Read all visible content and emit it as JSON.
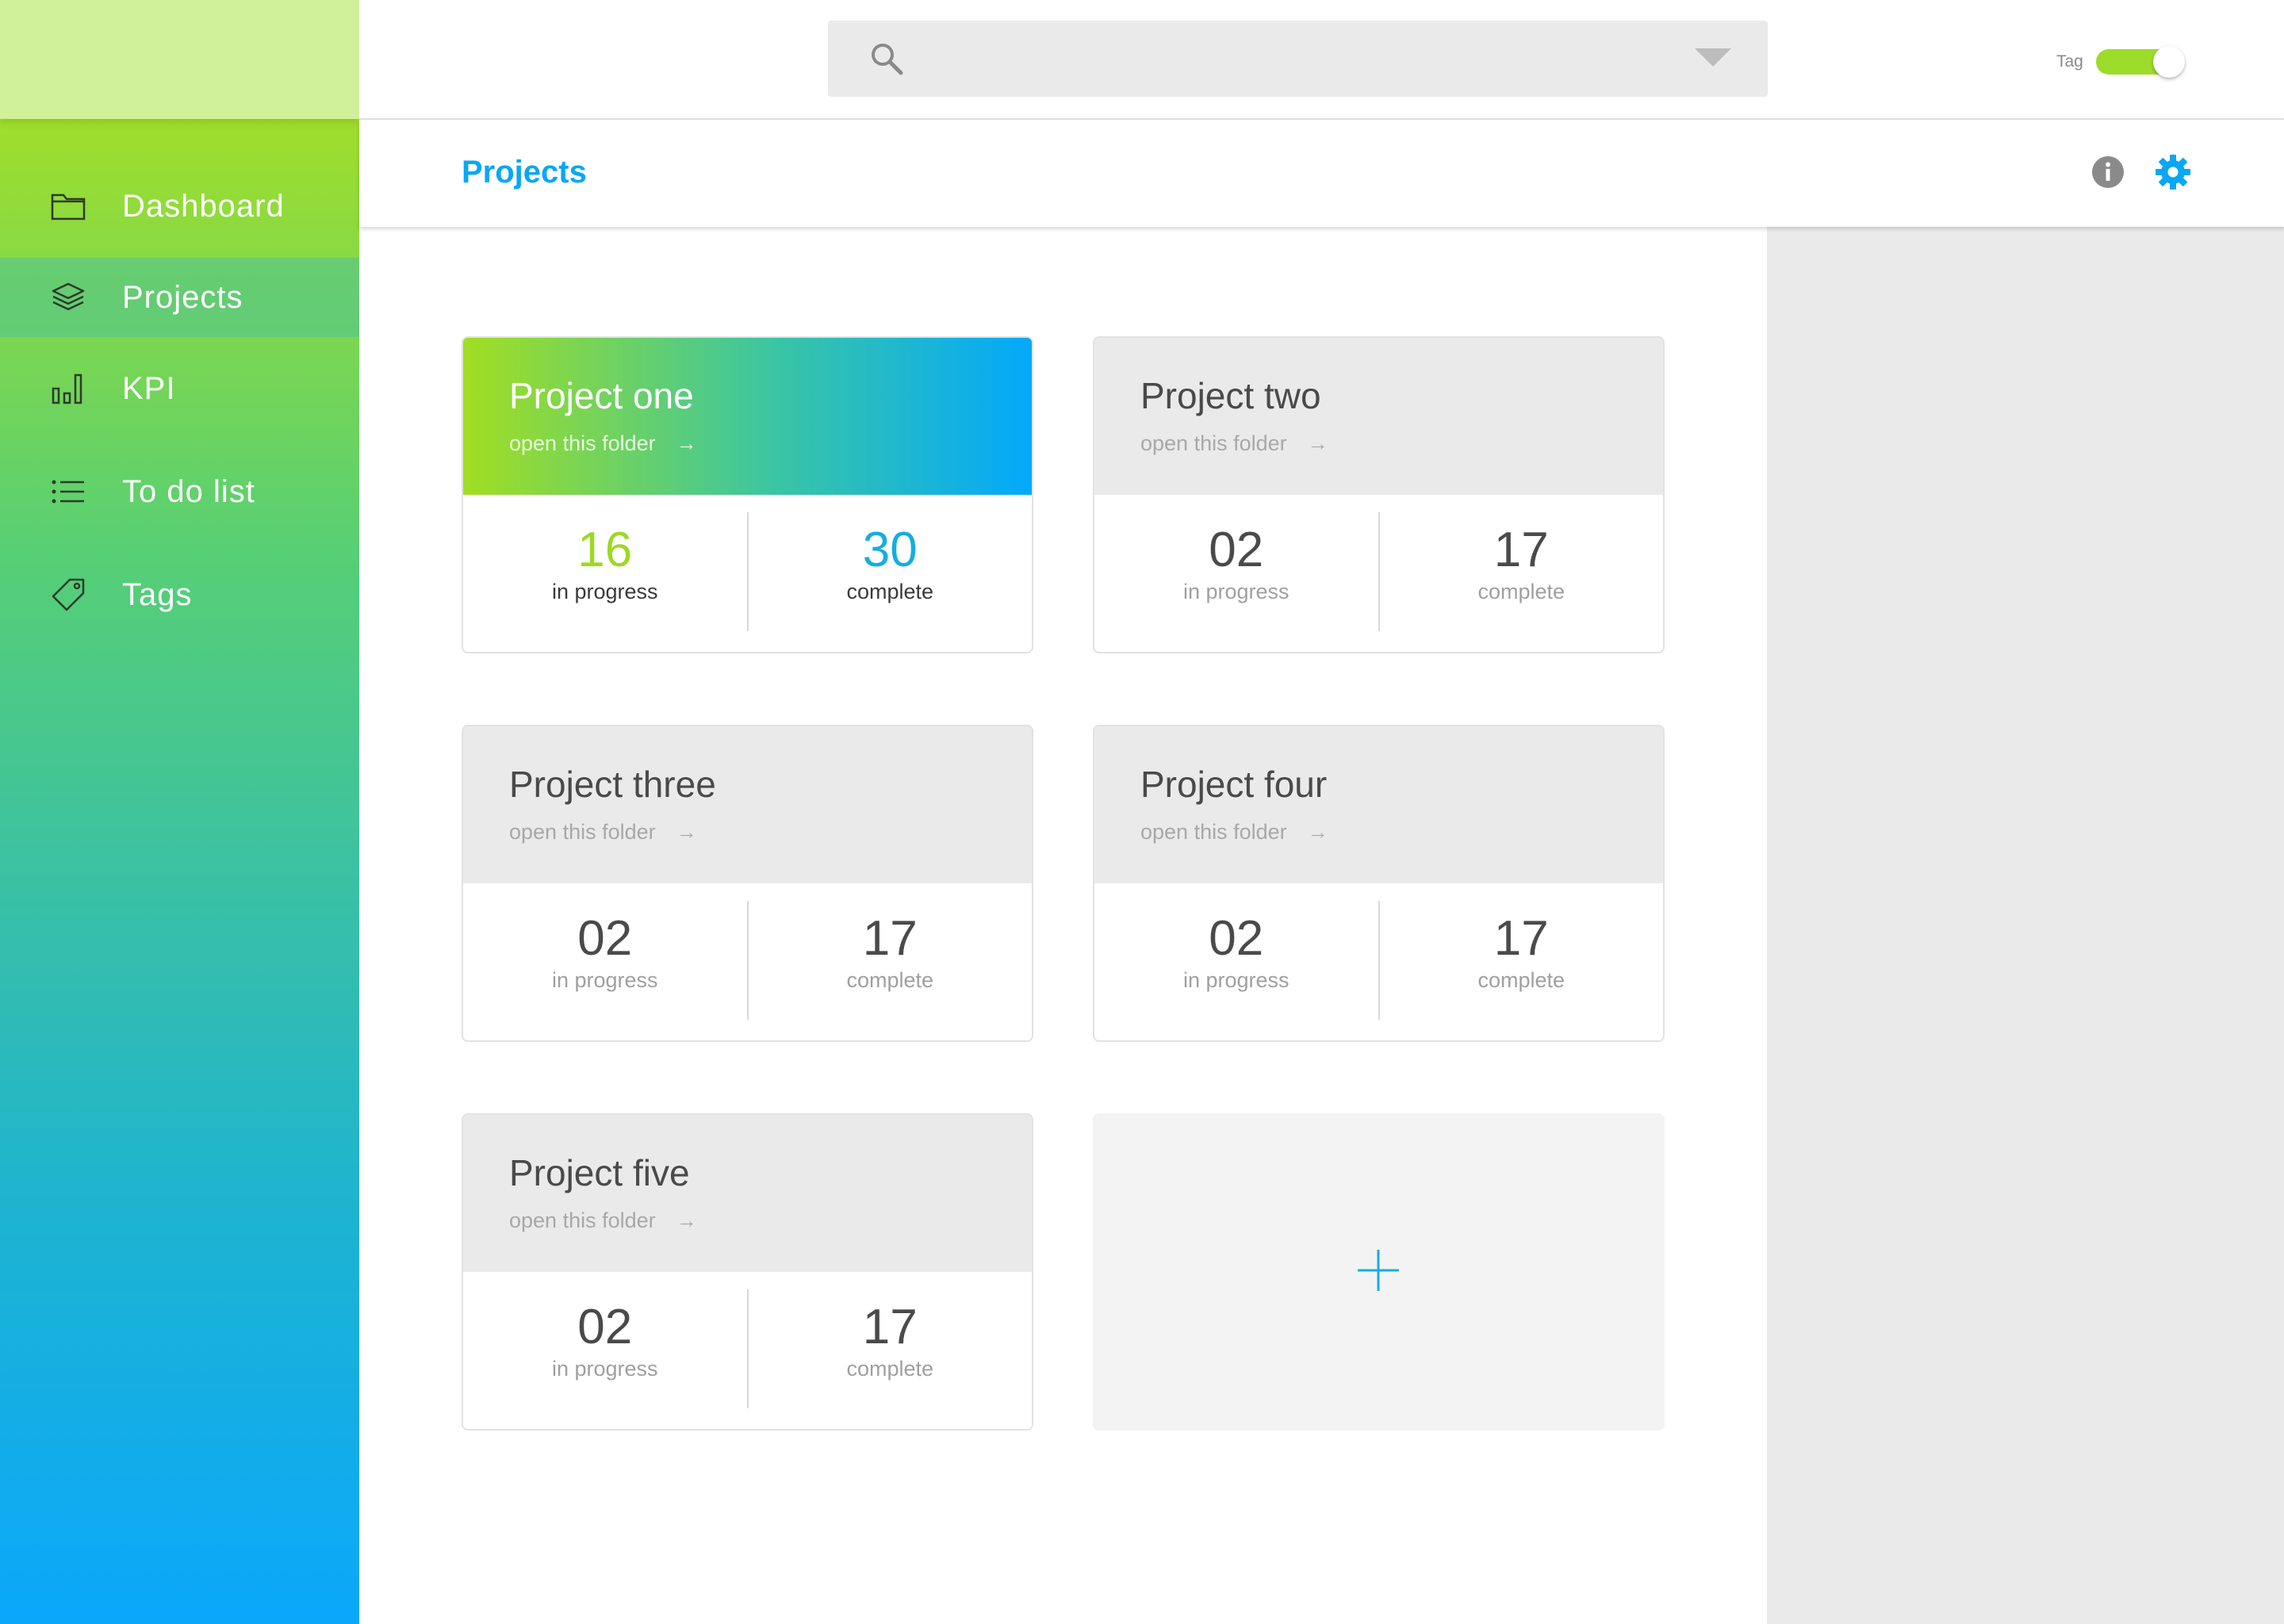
{
  "sidebar": {
    "items": [
      {
        "label": "Dashboard",
        "icon": "folder-icon"
      },
      {
        "label": "Projects",
        "icon": "layers-icon",
        "active": true
      },
      {
        "label": "KPI",
        "icon": "bar-chart-icon"
      },
      {
        "label": "To do list",
        "icon": "list-icon"
      },
      {
        "label": "Tags",
        "icon": "tag-icon"
      }
    ]
  },
  "topbar": {
    "search_value": "",
    "tag_label": "Tag",
    "tag_toggle_on": true
  },
  "header": {
    "title": "Projects"
  },
  "projects": [
    {
      "title": "Project one",
      "link": "open this folder",
      "in_progress": "16",
      "in_progress_label": "in progress",
      "complete": "30",
      "complete_label": "complete",
      "highlighted": true
    },
    {
      "title": "Project two",
      "link": "open this folder",
      "in_progress": "02",
      "in_progress_label": "in progress",
      "complete": "17",
      "complete_label": "complete"
    },
    {
      "title": "Project three",
      "link": "open this folder",
      "in_progress": "02",
      "in_progress_label": "in progress",
      "complete": "17",
      "complete_label": "complete"
    },
    {
      "title": "Project four",
      "link": "open this folder",
      "in_progress": "02",
      "in_progress_label": "in progress",
      "complete": "17",
      "complete_label": "complete"
    },
    {
      "title": "Project five",
      "link": "open this folder",
      "in_progress": "02",
      "in_progress_label": "in progress",
      "complete": "17",
      "complete_label": "complete"
    }
  ],
  "colors": {
    "accent_blue": "#0aa7f5",
    "accent_green": "#9ddc2b"
  }
}
